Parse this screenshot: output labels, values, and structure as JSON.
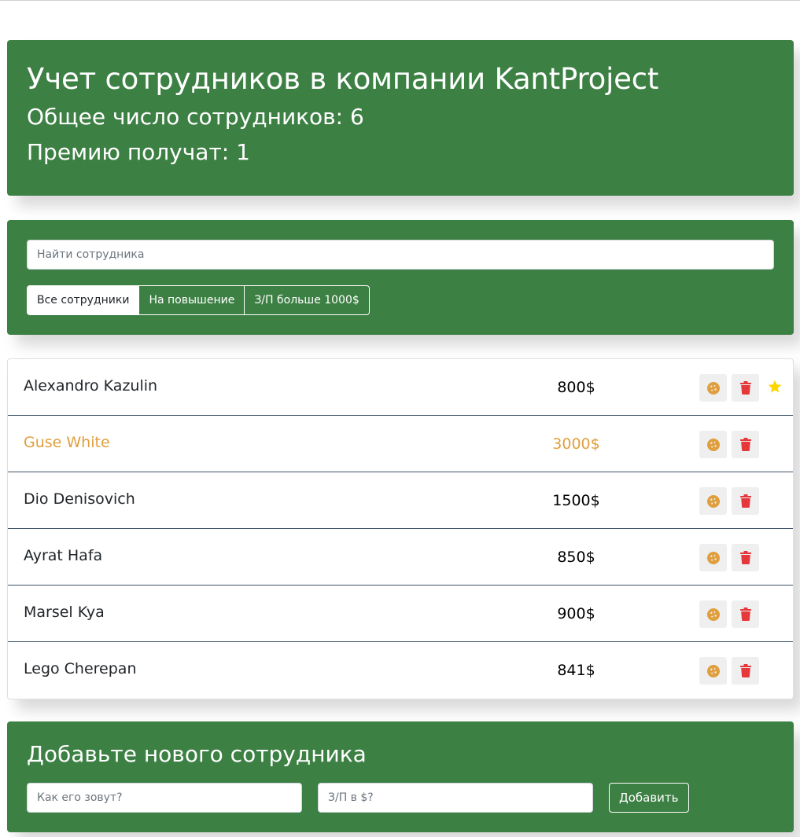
{
  "header": {
    "title": "Учет сотрудников в компании KantProject",
    "total_label": "Общее число сотрудников: 6",
    "bonus_label": "Премию получат: 1"
  },
  "search": {
    "placeholder": "Найти сотрудника",
    "filters": [
      {
        "label": "Все сотрудники",
        "active": true
      },
      {
        "label": "На повышение",
        "active": false
      },
      {
        "label": "З/П больше 1000$",
        "active": false
      }
    ]
  },
  "employees": [
    {
      "name": "Alexandro Kazulin",
      "salary": "800$",
      "increase": false,
      "rise": true
    },
    {
      "name": "Guse White",
      "salary": "3000$",
      "increase": true,
      "rise": false
    },
    {
      "name": "Dio Denisovich",
      "salary": "1500$",
      "increase": false,
      "rise": false
    },
    {
      "name": "Ayrat Hafa",
      "salary": "850$",
      "increase": false,
      "rise": false
    },
    {
      "name": "Marsel Kya",
      "salary": "900$",
      "increase": false,
      "rise": false
    },
    {
      "name": "Lego Cherepan",
      "salary": "841$",
      "increase": false,
      "rise": false
    }
  ],
  "icons": {
    "increase": "cookie-icon",
    "delete": "trash-icon",
    "rise": "star-icon"
  },
  "colors": {
    "panel": "#3d8044",
    "highlight": "#e09f3e",
    "delete": "#e5383b",
    "star": "#ffd700"
  },
  "add_form": {
    "title": "Добавьте нового сотрудника",
    "name_placeholder": "Как его зовут?",
    "salary_placeholder": "З/П в $?",
    "submit_label": "Добавить"
  }
}
